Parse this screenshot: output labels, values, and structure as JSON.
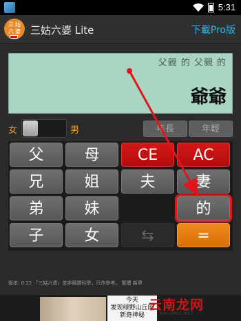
{
  "status_bar": {
    "time": "5:31"
  },
  "app_bar": {
    "icon_chars": [
      "三",
      "姑",
      "六",
      "婆"
    ],
    "title": "三姑六婆 Lite",
    "download_link": "下載Pro版"
  },
  "display": {
    "expression": "父親 的 父親 的",
    "result": "爺爺"
  },
  "gender": {
    "female_label": "女",
    "male_label": "男"
  },
  "age_buttons": {
    "older": "年長",
    "younger": "年輕"
  },
  "keys": [
    {
      "label": "父",
      "style": "gray"
    },
    {
      "label": "母",
      "style": "gray"
    },
    {
      "label": "CE",
      "style": "red"
    },
    {
      "label": "AC",
      "style": "red"
    },
    {
      "label": "兄",
      "style": "gray"
    },
    {
      "label": "姐",
      "style": "gray"
    },
    {
      "label": "夫",
      "style": "gray"
    },
    {
      "label": "妻",
      "style": "gray"
    },
    {
      "label": "弟",
      "style": "gray"
    },
    {
      "label": "妹",
      "style": "gray"
    },
    {
      "label": "",
      "style": "none"
    },
    {
      "label": "的",
      "style": "gray",
      "highlighted": true
    },
    {
      "label": "子",
      "style": "gray"
    },
    {
      "label": "女",
      "style": "gray"
    },
    {
      "label": "⇆",
      "style": "dark"
    },
    {
      "label": "=",
      "style": "orange"
    }
  ],
  "footer": {
    "text": "版本: 0.22 「三姑六婆」並非稱謂科學，只作參考。 繁體 新界"
  },
  "ad": {
    "line1": "今天",
    "line2": "发现绿野山丘的",
    "line3": "新奇神秘",
    "watermark": "云南龙网",
    "watermark_sub": "NNLONG.NET"
  },
  "colors": {
    "accent_blue": "#33b5e5",
    "display_bg": "#a9d6c2",
    "red_key": "#c61010",
    "orange_key": "#e07a12",
    "gender_label": "#e8a020",
    "annotation_red": "#e3141c"
  }
}
